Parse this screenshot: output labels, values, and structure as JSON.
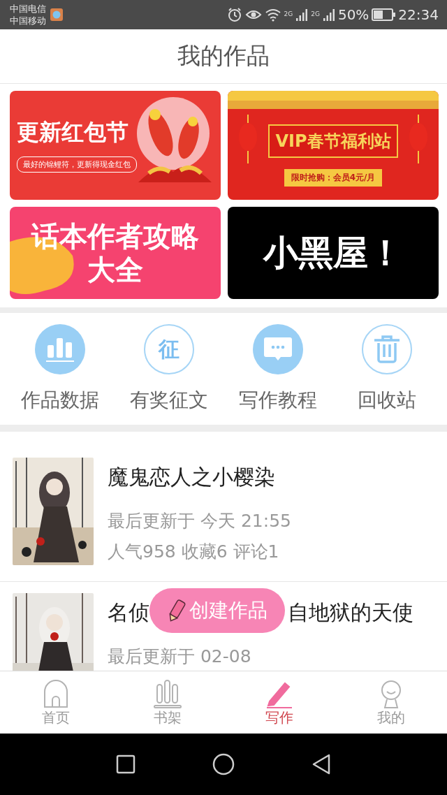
{
  "status_bar": {
    "carriers": [
      "中国电信",
      "中国移动"
    ],
    "network_labels": [
      "2G",
      "2G"
    ],
    "battery": "50%",
    "time": "22:34"
  },
  "header": {
    "title": "我的作品"
  },
  "banners": [
    {
      "kind": "koi",
      "title": "更新红包节",
      "subtitle": "最好的锦鲤符，更新得现金红包"
    },
    {
      "kind": "vip",
      "title": "VIP春节福利站",
      "subtitle": "限时抢购：会员4元/月"
    },
    {
      "kind": "guide",
      "lines": [
        "话本作者攻略",
        "大全"
      ]
    },
    {
      "kind": "dark",
      "lines": [
        "小黑屋！"
      ]
    }
  ],
  "shortcuts": [
    {
      "kind": "chart",
      "filled": true,
      "label": "作品数据"
    },
    {
      "kind": "glyph",
      "filled": false,
      "glyph": "征",
      "label": "有奖征文"
    },
    {
      "kind": "chat",
      "filled": true,
      "label": "写作教程"
    },
    {
      "kind": "trash",
      "filled": false,
      "label": "回收站"
    }
  ],
  "works": [
    {
      "cover": {
        "kind": "picture"
      },
      "title_parts": [
        "魔鬼恋人之小樱染"
      ],
      "updated": "最后更新于 今天 21:55",
      "stats": "人气958 收藏6 评论1"
    },
    {
      "cover": {
        "kind": "picture"
      },
      "title_parts": [
        "名侦",
        "自地狱的天使"
      ],
      "updated": "最后更新于 02-08"
    }
  ],
  "create_button": {
    "label": "创建作品"
  },
  "tabs": [
    {
      "kind": "home",
      "label": "首页",
      "selected": false
    },
    {
      "kind": "shelf",
      "label": "书架",
      "selected": false
    },
    {
      "kind": "write",
      "label": "写作",
      "selected": true
    },
    {
      "kind": "me",
      "label": "我的",
      "selected": false
    }
  ]
}
